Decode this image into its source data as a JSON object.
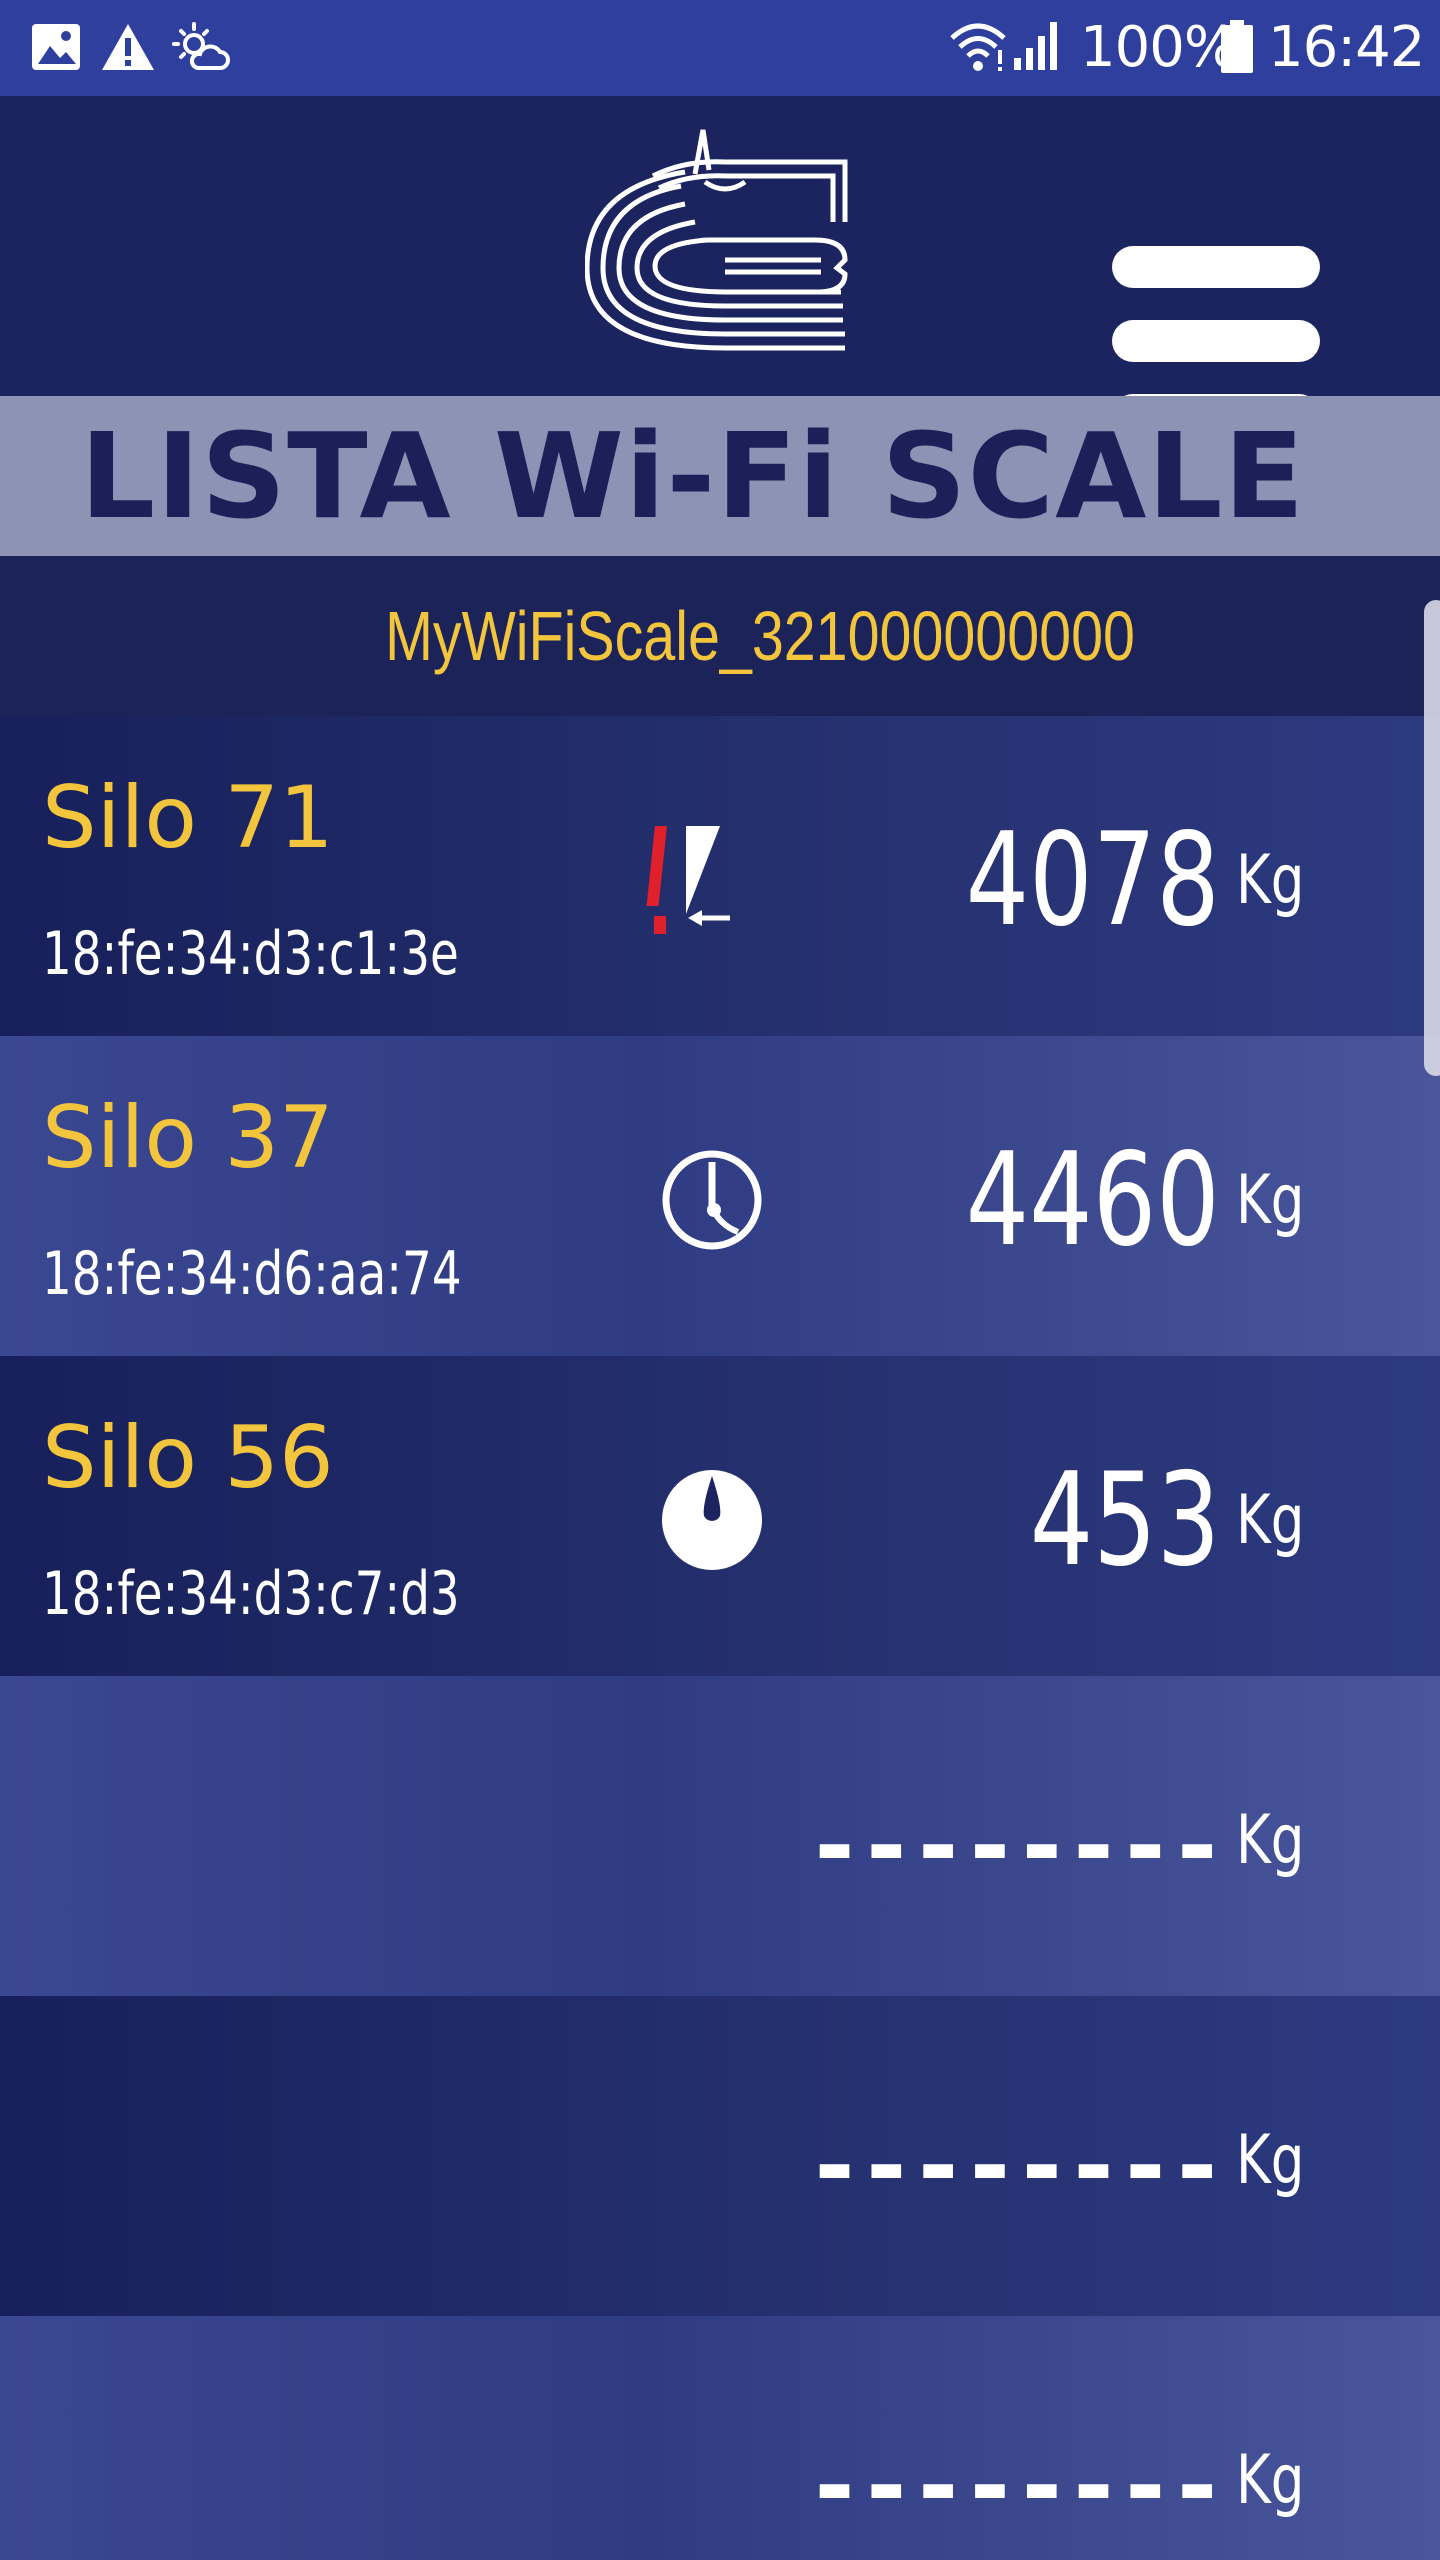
{
  "status_bar": {
    "icons_left": [
      "image-icon",
      "warning-icon",
      "weather-icon"
    ],
    "icons_right": [
      "wifi-icon",
      "signal-icon",
      "battery-icon"
    ],
    "battery": "100%",
    "time": "16:42"
  },
  "header": {
    "logo": "horse-head-logo",
    "menu_icon": "hamburger-menu-icon"
  },
  "title": "LISTA Wi-Fi SCALE",
  "network": "MyWiFiScale_321000000000",
  "scales": [
    {
      "name": "Silo 71",
      "mac": "18:fe:34:d3:c1:3e",
      "status_icon": "alert-arrow-icon",
      "weight": "4078",
      "unit": "Kg"
    },
    {
      "name": "Silo 37",
      "mac": "18:fe:34:d6:aa:74",
      "status_icon": "clock-timer-icon",
      "weight": "4460",
      "unit": "Kg"
    },
    {
      "name": "Silo 56",
      "mac": "18:fe:34:d3:c7:d3",
      "status_icon": "drop-gauge-icon",
      "weight": "453",
      "unit": "Kg"
    },
    {
      "name": "",
      "mac": "",
      "status_icon": "",
      "weight": "--------",
      "unit": "Kg"
    },
    {
      "name": "",
      "mac": "",
      "status_icon": "",
      "weight": "--------",
      "unit": "Kg"
    },
    {
      "name": "",
      "mac": "",
      "status_icon": "",
      "weight": "--------",
      "unit": "Kg"
    }
  ],
  "colors": {
    "status_bar": "#2f3f9e",
    "header": "#1c2460",
    "title_band": "#8c93b5",
    "title_text": "#1b2158",
    "accent_yellow": "#f2c53d",
    "alert_red": "#e0202a"
  }
}
